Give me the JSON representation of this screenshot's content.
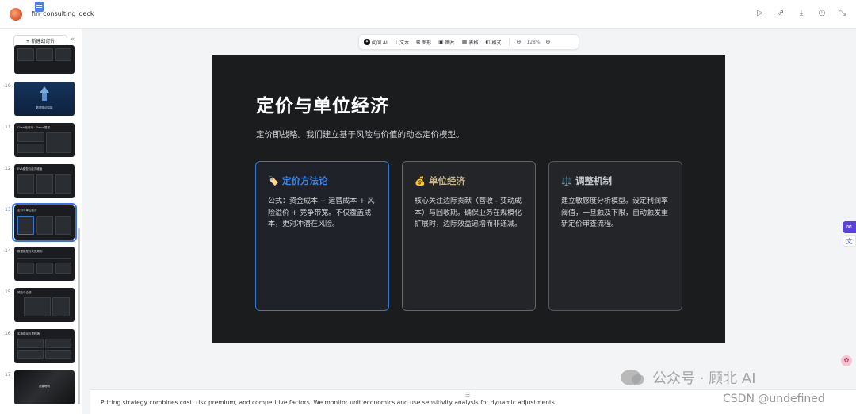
{
  "app": {
    "doc_title": "fin_consulting_deck",
    "top_actions": [
      "play-icon",
      "share-icon",
      "download-icon",
      "history-icon",
      "collapse-icon"
    ]
  },
  "sidebar": {
    "new_slide_label": "+ 新建幻灯片",
    "collapse_glyph": "«",
    "slides": [
      {
        "num": "",
        "style": "dark",
        "title": ""
      },
      {
        "num": "10",
        "style": "blue",
        "title": "数据驱动智能"
      },
      {
        "num": "11",
        "style": "dark",
        "title": "Chart化驱动 · Demo展现"
      },
      {
        "num": "12",
        "style": "dark",
        "title": "EVA模型与经济增值"
      },
      {
        "num": "13",
        "style": "dark",
        "title": "定价与单位经济",
        "selected": true
      },
      {
        "num": "14",
        "style": "dark",
        "title": "数据模型与决策规则"
      },
      {
        "num": "15",
        "style": "dark",
        "title": "风险与合规"
      },
      {
        "num": "16",
        "style": "dark",
        "title": "实施路径与里程碑"
      },
      {
        "num": "17",
        "style": "dark",
        "title": "谢谢聆听"
      }
    ]
  },
  "toolbar": {
    "ai": "问问 AI",
    "text": "文本",
    "shape": "图形",
    "image": "图片",
    "table": "表格",
    "format": "格式",
    "zoom_out": "⊖",
    "zoom": "128%",
    "zoom_in": "⊕"
  },
  "slide": {
    "title": "定价与单位经济",
    "subtitle": "定价即战略。我们建立基于风险与价值的动态定价模型。",
    "cards": [
      {
        "icon": "🏷️",
        "title": "定价方法论",
        "body": "公式：资金成本 + 运营成本 + 风险溢价 + 竞争带宽。不仅覆盖成本，更对冲潜在风险。"
      },
      {
        "icon": "💰",
        "title": "单位经济",
        "body": "核心关注边际贡献（营收 - 变动成本）与回收期。确保业务在规模化扩展时，边际效益递增而非递减。"
      },
      {
        "icon": "⚖️",
        "title": "调整机制",
        "body": "建立敏感度分析模型。设定利润率阈值，一旦触及下限，自动触发重新定价审查流程。"
      }
    ]
  },
  "notes": {
    "text": "Pricing strategy combines cost, risk premium, and competitive factors. We monitor unit economics and use sensitivity analysis for dynamic adjustments."
  },
  "watermark": {
    "line1": "公众号 · 顾北 AI",
    "line2": "CSDN @undefined"
  }
}
